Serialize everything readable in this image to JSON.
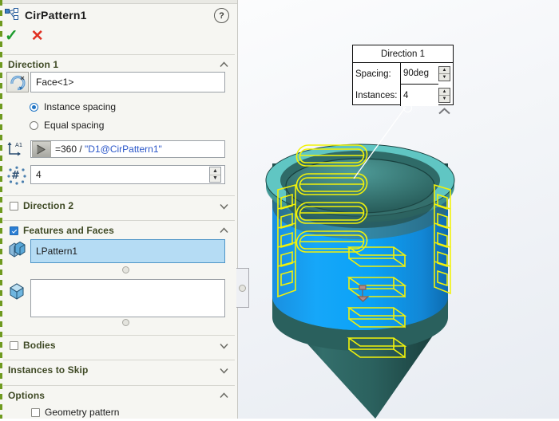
{
  "app": {
    "feature_icon": "circular-pattern-icon",
    "title": "CirPattern1",
    "help_label": "?",
    "ok_label": "✓",
    "cancel_label": "✕"
  },
  "sections": {
    "direction1": {
      "title": "Direction 1",
      "state": "expanded",
      "axis_field_value": "Face<1>",
      "axis_icon": "rotation-axis-icon",
      "spacing_mode": {
        "options": [
          "Instance spacing",
          "Equal spacing"
        ],
        "selected": "Instance spacing"
      },
      "angle_icon": "angle-dimension-icon",
      "equation_icon": "equation-sigma-icon",
      "angle_value_prefix": "=360 / ",
      "angle_value_ref": "\"D1@CirPattern1\"",
      "instances_icon": "instance-count-icon",
      "instances_value": "4"
    },
    "direction2": {
      "title": "Direction 2",
      "checked": false,
      "state": "collapsed"
    },
    "features_and_faces": {
      "title": "Features and Faces",
      "checked": true,
      "state": "expanded",
      "feature_icon": "feature-solid-icon",
      "feature_value": "LPattern1",
      "face_icon": "face-box-icon",
      "face_value": ""
    },
    "bodies": {
      "title": "Bodies",
      "checked": false,
      "state": "collapsed"
    },
    "instances_to_skip": {
      "title": "Instances to Skip",
      "state": "collapsed"
    },
    "options": {
      "title": "Options",
      "state": "expanded",
      "geometry_pattern": {
        "label": "Geometry pattern",
        "checked": false
      }
    }
  },
  "callout": {
    "title": "Direction 1",
    "rows": [
      {
        "label": "Spacing:",
        "value": "90deg"
      },
      {
        "label": "Instances:",
        "value": "4"
      }
    ]
  },
  "viewport": {
    "colors": {
      "body": "#2f6b68",
      "selected_face": "#0aa2f7",
      "preview": "#f2f20a",
      "rim": "#53b8b6",
      "background_top": "#ffffff",
      "background_bottom": "#e8ecf2"
    }
  }
}
